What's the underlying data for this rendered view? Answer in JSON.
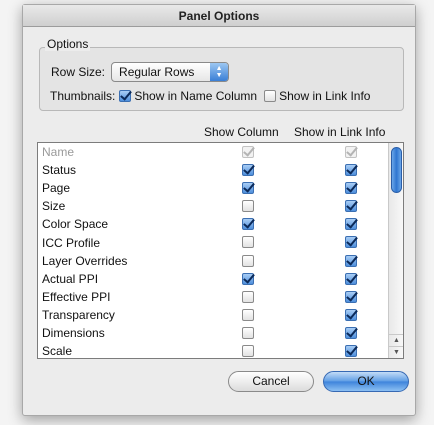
{
  "window": {
    "title": "Panel Options"
  },
  "options": {
    "legend": "Options",
    "row_size_label": "Row Size:",
    "row_size_value": "Regular Rows",
    "thumbnails_label": "Thumbnails:",
    "show_in_name_column": {
      "label": "Show in Name Column",
      "checked": true
    },
    "show_in_link_info": {
      "label": "Show in Link Info",
      "checked": false
    }
  },
  "table": {
    "headers": [
      "Show Column",
      "Show in Link Info"
    ],
    "rows": [
      {
        "name": "Name",
        "show_column": true,
        "link_info": true,
        "disabled": true
      },
      {
        "name": "Status",
        "show_column": true,
        "link_info": true
      },
      {
        "name": "Page",
        "show_column": true,
        "link_info": true
      },
      {
        "name": "Size",
        "show_column": false,
        "link_info": true
      },
      {
        "name": "Color Space",
        "show_column": true,
        "link_info": true
      },
      {
        "name": "ICC Profile",
        "show_column": false,
        "link_info": true
      },
      {
        "name": "Layer Overrides",
        "show_column": false,
        "link_info": true
      },
      {
        "name": "Actual PPI",
        "show_column": true,
        "link_info": true
      },
      {
        "name": "Effective PPI",
        "show_column": false,
        "link_info": true
      },
      {
        "name": "Transparency",
        "show_column": false,
        "link_info": true
      },
      {
        "name": "Dimensions",
        "show_column": false,
        "link_info": true
      },
      {
        "name": "Scale",
        "show_column": false,
        "link_info": true
      }
    ]
  },
  "buttons": {
    "cancel": "Cancel",
    "ok": "OK"
  },
  "colors": {
    "accent": "#3d83db",
    "check_mark": "#0b2a5a"
  }
}
